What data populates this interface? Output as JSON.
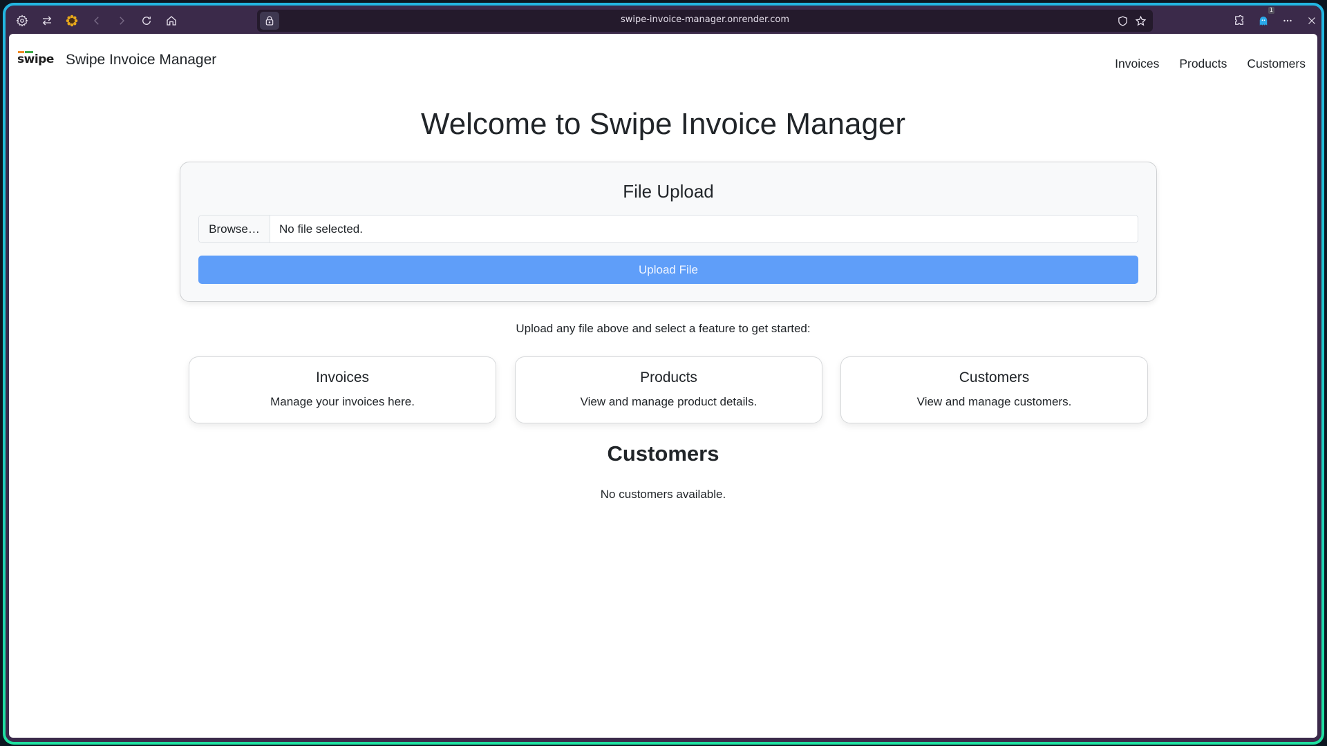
{
  "browser": {
    "url": "swipe-invoice-manager.onrender.com",
    "extension_badge": "1",
    "icons": {
      "settings": "gear-icon",
      "tabs": "swap-arrows-icon",
      "profile": "sunflower-icon",
      "back": "chevron-left-icon",
      "forward": "chevron-right-icon",
      "reload": "reload-icon",
      "home": "home-icon",
      "lock": "lock-icon",
      "shield": "shield-icon",
      "bookmark": "star-icon",
      "extensions": "puzzle-icon",
      "ghost_extension": "ghost-icon",
      "menu": "more-horizontal-icon",
      "close": "close-icon"
    }
  },
  "navbar": {
    "logo_text": "swipe",
    "brand": "Swipe Invoice Manager",
    "links": [
      "Invoices",
      "Products",
      "Customers"
    ]
  },
  "main": {
    "title": "Welcome to Swipe Invoice Manager",
    "upload": {
      "title": "File Upload",
      "browse_label": "Browse…",
      "file_status": "No file selected.",
      "button_label": "Upload File"
    },
    "hint": "Upload any file above and select a feature to get started:",
    "features": [
      {
        "title": "Invoices",
        "description": "Manage your invoices here."
      },
      {
        "title": "Products",
        "description": "View and manage product details."
      },
      {
        "title": "Customers",
        "description": "View and manage customers."
      }
    ],
    "section_title": "Customers",
    "empty_message": "No customers available."
  },
  "colors": {
    "primary_button": "#5f9ef9",
    "browser_chrome": "#3b2a4a",
    "logo_accent_orange": "#f08a24",
    "logo_accent_green": "#3aa845"
  }
}
